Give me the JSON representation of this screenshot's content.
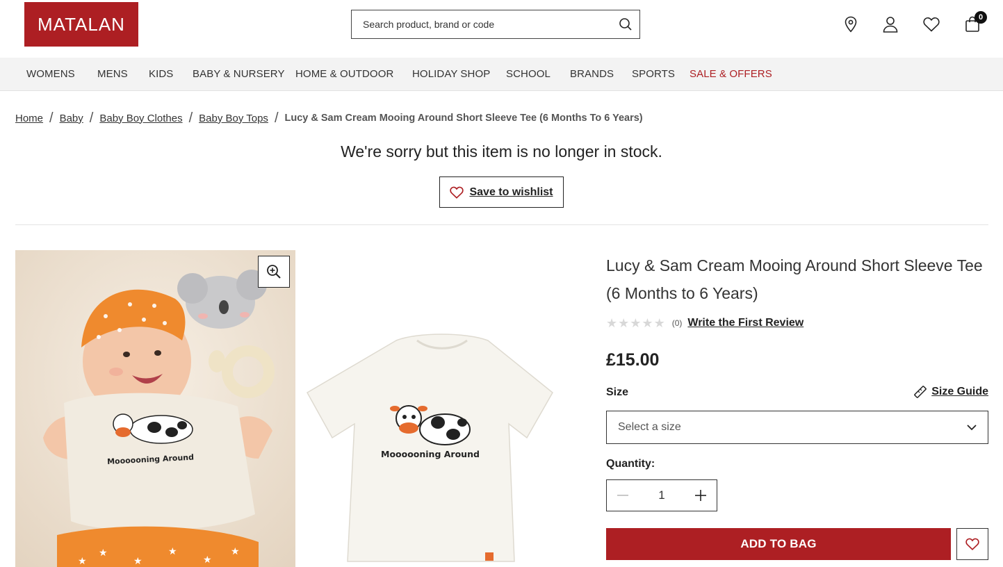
{
  "header": {
    "logo_text": "MATALAN",
    "search_placeholder": "Search product, brand or code",
    "bag_count": "0"
  },
  "nav": {
    "items": [
      {
        "label": "WOMENS"
      },
      {
        "label": "MENS"
      },
      {
        "label": "KIDS"
      },
      {
        "label": "BABY & NURSERY"
      },
      {
        "label": "HOME & OUTDOOR"
      },
      {
        "label": "HOLIDAY SHOP"
      },
      {
        "label": "SCHOOL"
      },
      {
        "label": "BRANDS"
      },
      {
        "label": "SPORTS"
      },
      {
        "label": "SALE & OFFERS"
      }
    ]
  },
  "breadcrumb": {
    "items": [
      {
        "label": "Home"
      },
      {
        "label": "Baby"
      },
      {
        "label": "Baby Boy Clothes"
      },
      {
        "label": "Baby Boy Tops"
      }
    ],
    "current": "Lucy & Sam Cream Mooing Around Short Sleeve Tee (6 Months To 6 Years)"
  },
  "stock_message": "We're sorry but this item is no longer in stock.",
  "save_wishlist_label": "Save to wishlist",
  "product": {
    "title": "Lucy & Sam Cream Mooing Around Short Sleeve Tee (6 Months to 6 Years)",
    "rating_count": "(0)",
    "review_link": "Write the First Review",
    "price": "£15.00",
    "size_label": "Size",
    "size_guide_label": "Size Guide",
    "size_placeholder": "Select a size",
    "quantity_label": "Quantity:",
    "quantity": "1",
    "add_to_bag": "ADD TO BAG",
    "print_text": "Moooooning Around"
  },
  "colors": {
    "brand": "#ad1f23",
    "nav_bg": "#f3f3f3"
  }
}
